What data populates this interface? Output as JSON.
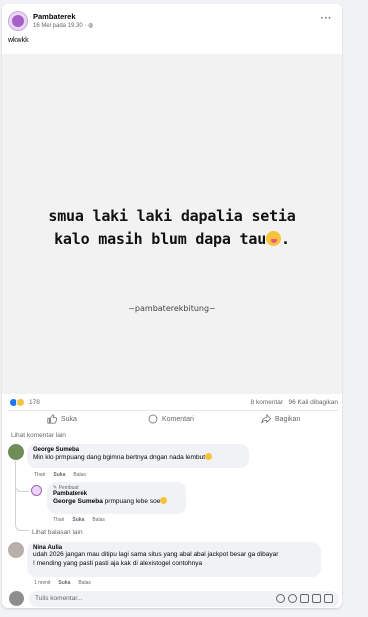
{
  "post": {
    "page_name": "Pambaterek",
    "meta": "16 Mei pada 19.30 · ",
    "caption": "wkwkk",
    "image_line1": "smua laki laki dapalia setia",
    "image_line2": "kalo masih blum dapa tau",
    "image_watermark": "~pambaterekbitung~"
  },
  "stats": {
    "reactions": "178",
    "comments": "8 komentar",
    "shares": "96 Kali dibagikan"
  },
  "actions": {
    "like": "Suka",
    "comment": "Komentari",
    "share": "Bagikan"
  },
  "more_comments": "Lihat komentar lain",
  "comments": [
    {
      "author": "George Sumeba",
      "text": "Min klo prmpuang dang bgimna bertnya dngan nada lembut",
      "time": "Thari",
      "like": "Suka",
      "reply": "Balas"
    },
    {
      "badge": "Pembuat",
      "author": "Pambaterek",
      "mention": "George Sumeba",
      "text": " prmpuang lebe soe",
      "time": "Thari",
      "like": "Suka",
      "reply": "Balas"
    },
    {
      "author": "Nina Aulia",
      "text_line1": "udah 2026 jangan mau ditipu lagi sama situs yang abal abal jackpot besar ga dibayar",
      "text_line2": "! mending yang pasti pasti aja kak di alexistogel contohnya",
      "time": "1 menit",
      "like": "Suka",
      "reply": "Balas"
    }
  ],
  "view_replies": "Lihat balasan lain",
  "input": {
    "placeholder": "Tulis komentar..."
  }
}
